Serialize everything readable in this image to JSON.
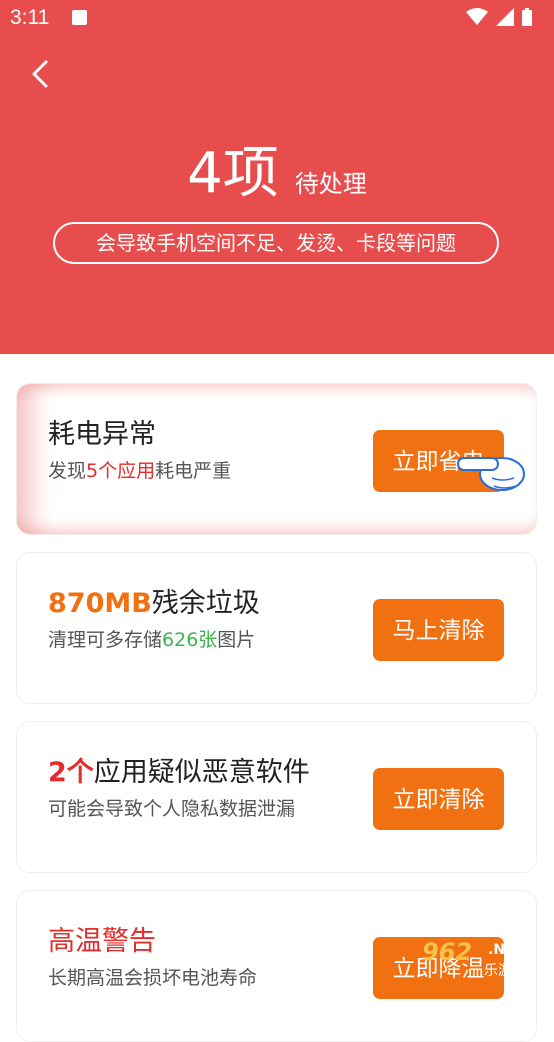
{
  "status": {
    "time": "3:11"
  },
  "header": {
    "count": "4项",
    "count_suffix": "待处理",
    "warning": "会导致手机空间不足、发烫、卡段等问题"
  },
  "cards": [
    {
      "title": "耗电异常",
      "desc_pre": "发现",
      "desc_hl": "5个应用",
      "desc_post": "耗电严重",
      "button": "立即省电"
    },
    {
      "title_hl": "870MB",
      "title_rest": "残余垃圾",
      "desc_pre": "清理可多存储",
      "desc_hl": "626张",
      "desc_post": "图片",
      "button": "马上清除"
    },
    {
      "title_hl": "2个",
      "title_rest": "应用疑似恶意软件",
      "desc": "可能会导致个人隐私数据泄漏",
      "button": "立即清除"
    },
    {
      "title": "高温警告",
      "desc": "长期高温会损坏电池寿命",
      "button": "立即降温"
    }
  ],
  "watermark": {
    "number": "962",
    "domain": ".NET",
    "text": "乐游网"
  },
  "colors": {
    "header": "#e84d4d",
    "button": "#f07012",
    "highlight_red": "#e62b2b",
    "highlight_green": "#3bb54a"
  }
}
